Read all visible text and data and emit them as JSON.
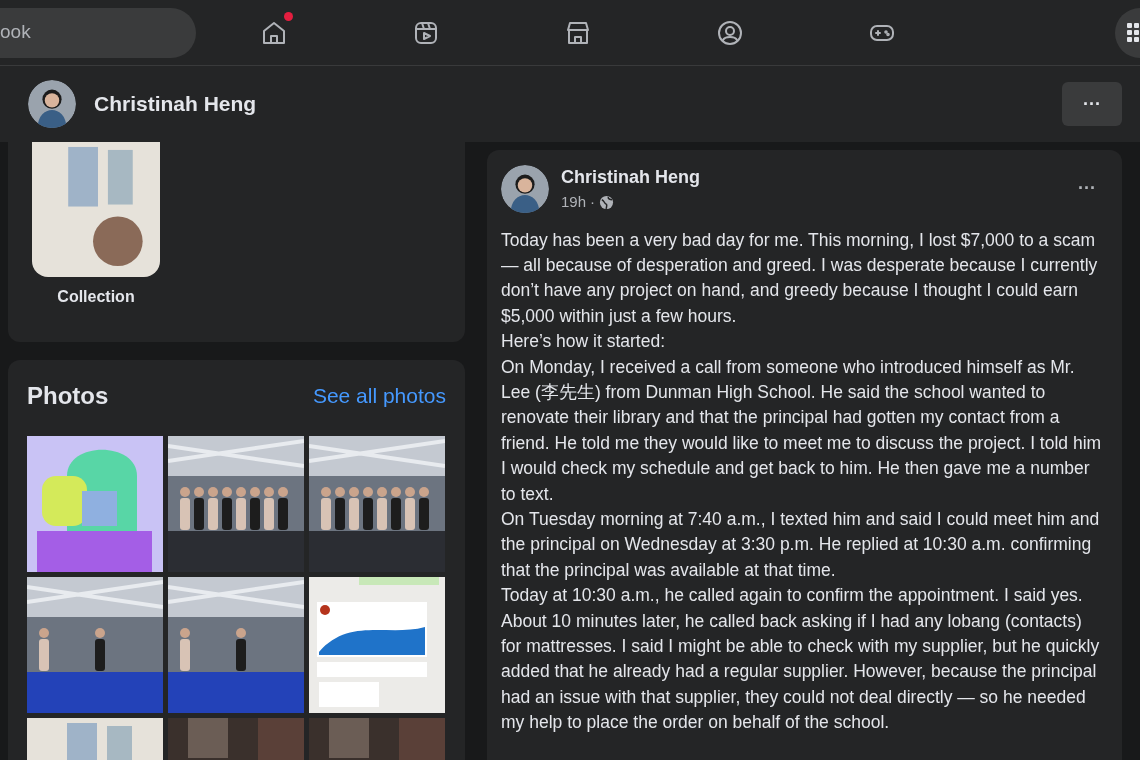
{
  "search": {
    "value": "ook"
  },
  "nav_items": [
    {
      "selected": false,
      "notification": true
    },
    {
      "selected": false,
      "notification": false
    },
    {
      "selected": false,
      "notification": false
    },
    {
      "selected": false,
      "notification": false
    },
    {
      "selected": false,
      "notification": false
    }
  ],
  "profile_bar": {
    "name": "Christinah Heng",
    "more": "···"
  },
  "collection": {
    "label": "Collection"
  },
  "photos": {
    "title": "Photos",
    "link": "See all photos"
  },
  "post": {
    "author": "Christinah Heng",
    "time": "19h",
    "separator": "·",
    "more": "···",
    "paragraphs": [
      "Today has been a very bad day for me. This morning, I lost $7,000 to a scam — all because of desperation and greed. I was desperate because I currently don’t have any project on hand, and greedy because I thought I could earn $5,000 within just a few hours.",
      "Here’s how it started:",
      "On Monday, I received a call from someone who introduced himself as Mr. Lee (李先生) from Dunman High School. He said the school wanted to renovate their library and that the principal had gotten my contact from a friend. He told me they would like to meet me to discuss the project. I told him I would check my schedule and get back to him. He then gave me a number to text.",
      "On Tuesday morning at 7:40 a.m., I texted him and said I could meet him and the principal on Wednesday at 3:30 p.m. He replied at 10:30 a.m. confirming that the principal was available at that time.",
      "Today at 10:30 a.m., he called again to confirm the appointment. I said yes. About 10 minutes later, he called back asking if I had any lobang (contacts) for mattresses. I said I might be able to check with my supplier, but he quickly added that he already had a regular supplier. However, because the principal had an issue with that supplier, they could not deal directly — so he needed my help to place the order on behalf of the school."
    ]
  }
}
